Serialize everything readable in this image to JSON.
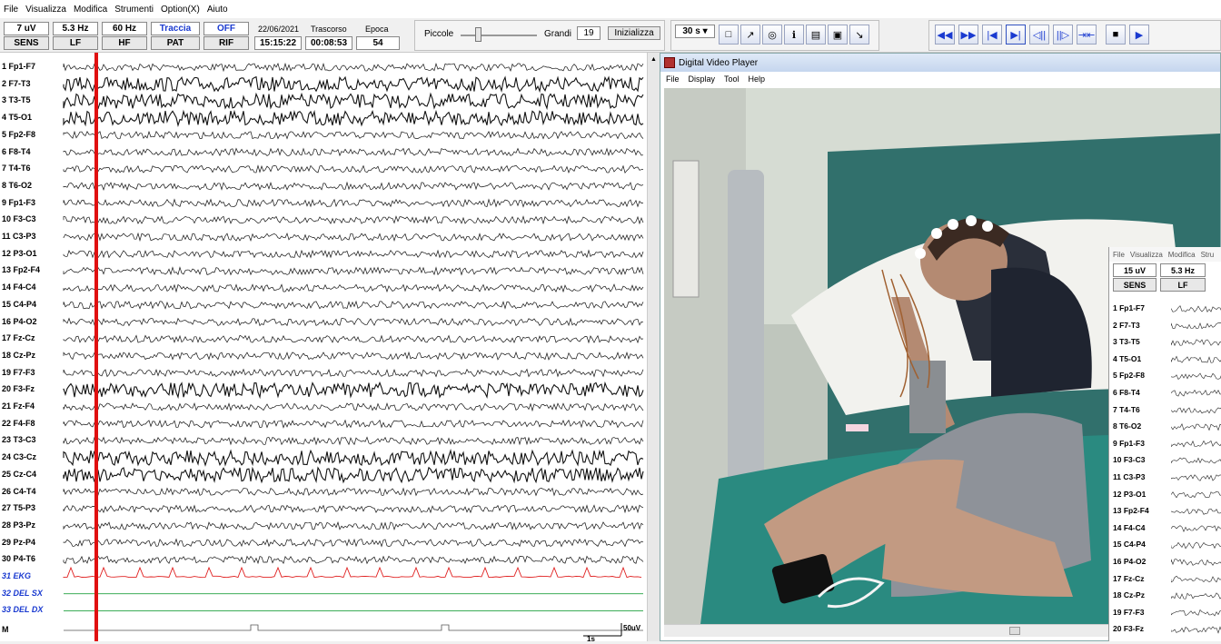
{
  "menu": [
    "File",
    "Visualizza",
    "Modifica",
    "Strumenti",
    "Option(X)",
    "Aiuto"
  ],
  "params": {
    "sens_value": "7 uV",
    "sens_label": "SENS",
    "lf_value": "5.3 Hz",
    "lf_label": "LF",
    "hf_value": "60 Hz",
    "hf_label": "HF",
    "trace_value": "Traccia",
    "trace_label": "PAT",
    "rif_value": "OFF",
    "rif_label": "RIF",
    "date": "22/06/2021",
    "time": "15:15:22",
    "elapsed_label": "Trascorso",
    "elapsed": "00:08:53",
    "epoch_label": "Epoca",
    "epoch": "54"
  },
  "size": {
    "small": "Piccole",
    "large": "Grandi",
    "value": "19",
    "init": "Inizializza"
  },
  "timebase": "30 s",
  "channels": [
    "1 Fp1-F7",
    "2 F7-T3",
    "3 T3-T5",
    "4 T5-O1",
    "5 Fp2-F8",
    "6 F8-T4",
    "7 T4-T6",
    "8 T6-O2",
    "9 Fp1-F3",
    "10 F3-C3",
    "11 C3-P3",
    "12 P3-O1",
    "13 Fp2-F4",
    "14 F4-C4",
    "15 C4-P4",
    "16 P4-O2",
    "17 Fz-Cz",
    "18 Cz-Pz",
    "19 F7-F3",
    "20 F3-Fz",
    "21 Fz-F4",
    "22 F4-F8",
    "23 T3-C3",
    "24 C3-Cz",
    "25 Cz-C4",
    "26 C4-T4",
    "27 T5-P3",
    "28 P3-Pz",
    "29 Pz-P4",
    "30 P4-T6"
  ],
  "special_channels": [
    "31 EKG",
    "32 DEL SX",
    "33 DEL DX"
  ],
  "marker_label": "M",
  "scale": {
    "amplitude": "50uV",
    "time": "1s"
  },
  "video": {
    "title": "Digital Video Player",
    "menu": [
      "File",
      "Display",
      "Tool",
      "Help"
    ]
  },
  "mini": {
    "menu": [
      "File",
      "Visualizza",
      "Modifica",
      "Stru"
    ],
    "sens": "15 uV",
    "lf": "5.3 Hz",
    "sens_label": "SENS",
    "lf_label": "LF",
    "channels": [
      "1 Fp1-F7",
      "2 F7-T3",
      "3 T3-T5",
      "4 T5-O1",
      "5 Fp2-F8",
      "6 F8-T4",
      "7 T4-T6",
      "8 T6-O2",
      "9 Fp1-F3",
      "10 F3-C3",
      "11 C3-P3",
      "12 P3-O1",
      "13 Fp2-F4",
      "14 F4-C4",
      "15 C4-P4",
      "16 P4-O2",
      "17 Fz-Cz",
      "18 Cz-Pz",
      "19 F7-F3",
      "20 F3-Fz"
    ]
  },
  "colors": {
    "cursor": "#e01010",
    "ekg": "#e02020",
    "delta": "#20a040",
    "label_blue": "#1a3ad0"
  }
}
